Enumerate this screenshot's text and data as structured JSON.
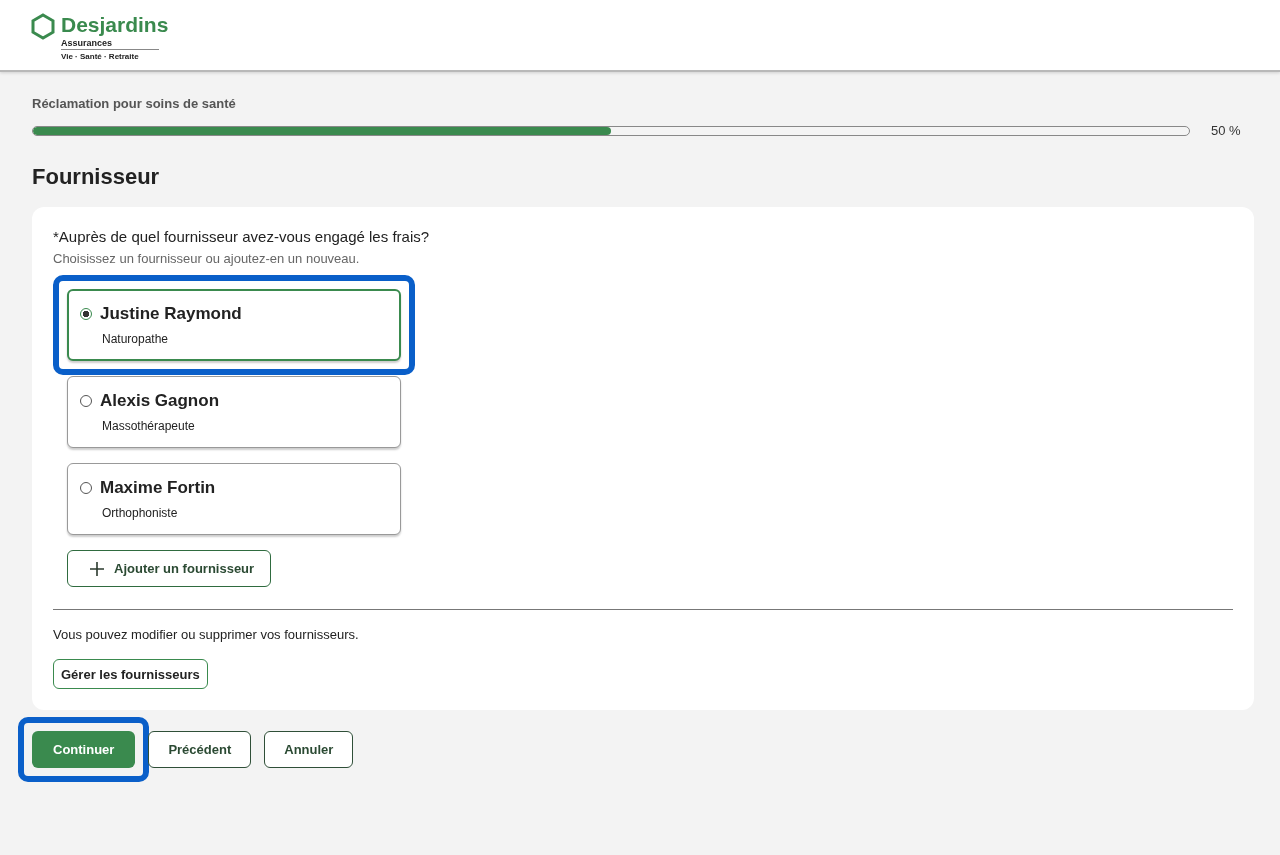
{
  "logo": {
    "name": "Desjardins",
    "subtitle": "Assurances",
    "tagline": "Vie · Santé · Retraite"
  },
  "progress": {
    "label": "Réclamation pour soins de santé",
    "level": 0.5,
    "reading": "50 %"
  },
  "heading": "Fournisseur",
  "question": {
    "label": "Auprès de quel fournisseur avez-vous engagé les frais?",
    "required_mark": "*",
    "hint": "Choisissez un fournisseur ou ajoutez-en un nouveau."
  },
  "providers": [
    {
      "name": "Justine Raymond",
      "role": "Naturopathe",
      "selected": true,
      "highlighted": true
    },
    {
      "name": "Alexis Gagnon",
      "role": "Massothérapeute",
      "selected": false,
      "highlighted": false
    },
    {
      "name": "Maxime Fortin",
      "role": "Orthophoniste",
      "selected": false,
      "highlighted": false
    }
  ],
  "add_button": "Ajouter un fournisseur",
  "manage_note": "Vous pouvez modifier ou supprimer vos fournisseurs.",
  "manage_button": "Gérer les fournisseurs",
  "actions": [
    {
      "label": "Continuer",
      "kind": "primary",
      "highlighted": true
    },
    {
      "label": "Précédent",
      "kind": "secondary",
      "highlighted": false
    },
    {
      "label": "Annuler",
      "kind": "secondary",
      "highlighted": false
    }
  ]
}
